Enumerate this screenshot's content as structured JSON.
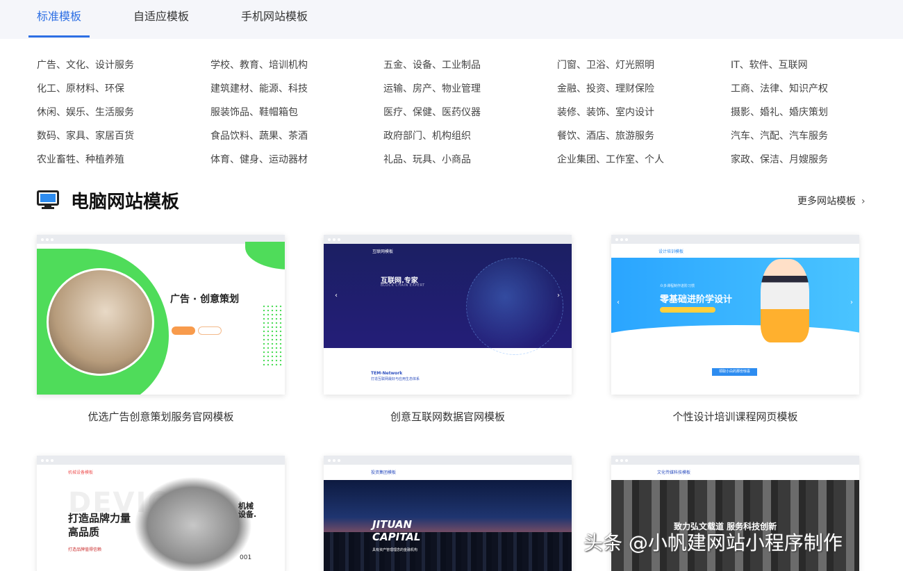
{
  "tabs": [
    {
      "label": "标准模板",
      "active": true
    },
    {
      "label": "自适应模板",
      "active": false
    },
    {
      "label": "手机网站模板",
      "active": false
    }
  ],
  "categories": [
    [
      "广告、文化、设计服务",
      "学校、教育、培训机构",
      "五金、设备、工业制品",
      "门窗、卫浴、灯光照明",
      "IT、软件、互联网"
    ],
    [
      "化工、原材料、环保",
      "建筑建材、能源、科技",
      "运输、房产、物业管理",
      "金融、投资、理财保险",
      "工商、法律、知识产权"
    ],
    [
      "休闲、娱乐、生活服务",
      "服装饰品、鞋帽箱包",
      "医疗、保健、医药仪器",
      "装修、装饰、室内设计",
      "摄影、婚礼、婚庆策划"
    ],
    [
      "数码、家具、家居百货",
      "食品饮料、蔬果、茶酒",
      "政府部门、机构组织",
      "餐饮、酒店、旅游服务",
      "汽车、汽配、汽车服务"
    ],
    [
      "农业畜牲、种植养殖",
      "体育、健身、运动器材",
      "礼品、玩具、小商品",
      "企业集团、工作室、个人",
      "家政、保洁、月嫂服务"
    ]
  ],
  "section": {
    "title": "电脑网站模板",
    "more_label": "更多网站模板",
    "more_chevron": "›",
    "icon": "monitor-icon"
  },
  "cards": [
    {
      "caption": "优选广告创意策划服务官网模板",
      "preview": {
        "headline": "广告 · 创意策划"
      }
    },
    {
      "caption": "创意互联网数据官网模板",
      "preview": {
        "logo": "互联网模板",
        "headline": "互联网.专家",
        "sub": "BLOCK CHAIN EXPERT",
        "line1": "TEM-Network",
        "line2": "打造互联网最好与应用生态体系",
        "prev": "‹",
        "next": "›"
      }
    },
    {
      "caption": "个性设计培训课程网页模板",
      "preview": {
        "logo": "设计培训模板",
        "small": "众多课程制作进阶习惯",
        "headline": "零基础进阶学设计",
        "button": "领取小白的那份惊喜",
        "prev": "‹",
        "next": "›"
      }
    },
    {
      "caption": "",
      "preview": {
        "logo": "机械设备模板",
        "bg": "DEVICE",
        "headline1": "打造品牌力量",
        "headline2": "高品质",
        "red": "打造品牌值得信赖",
        "side1": "机械",
        "side2": "设备.",
        "num": "001"
      }
    },
    {
      "caption": "",
      "preview": {
        "logo": "投资集团模板",
        "headline1": "JITUAN",
        "headline2": "CAPITAL",
        "sub": "具有资产管理理念的金融机构"
      }
    },
    {
      "caption": "",
      "preview": {
        "logo": "文化传媒科技模板",
        "headline": "致力弘文载道 服务科技创新"
      }
    }
  ],
  "watermark": "头条 @小帆建网站小程序制作",
  "colors": {
    "accent": "#2d6fe4",
    "tabbar_bg": "#f5f6fa",
    "green": "#4fdc5a",
    "orange": "#f89b4c"
  }
}
